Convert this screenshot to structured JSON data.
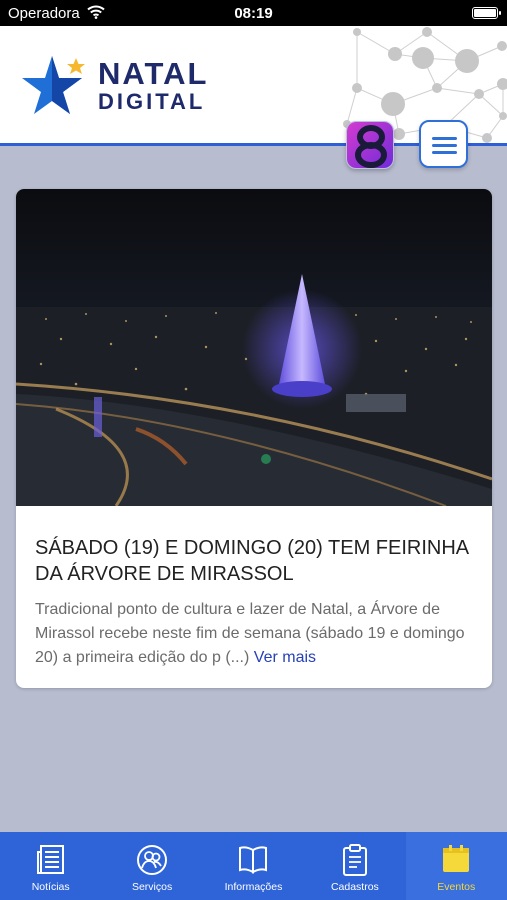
{
  "status_bar": {
    "carrier": "Operadora",
    "time": "08:19",
    "battery_level": 1.0
  },
  "header": {
    "logo_line1": "NATAL",
    "logo_line2": "DIGITAL",
    "colors": {
      "brand_navy": "#1f2a6b",
      "brand_blue": "#2f6fd8",
      "star_yellow": "#f5b82e"
    }
  },
  "app_badge": {
    "icon": "eight-app-icon"
  },
  "menu": {
    "icon": "hamburger-icon"
  },
  "event_card": {
    "title": "SÁBADO (19) E DOMINGO (20) TEM FEIRINHA DA ÁRVORE DE MIRASSOL",
    "summary": "Tradicional ponto de cultura e lazer de Natal, a Árvore de Mirassol recebe neste fim de semana (sábado 19 e domingo 20) a primeira edição do p (...)",
    "read_more": "Ver mais"
  },
  "tabbar": {
    "active_index": 4,
    "active_color": "#f5d83a",
    "tabs": [
      {
        "label": "Notícias",
        "icon": "newspaper-icon"
      },
      {
        "label": "Serviços",
        "icon": "people-icon"
      },
      {
        "label": "Informações",
        "icon": "book-icon"
      },
      {
        "label": "Cadastros",
        "icon": "clipboard-icon"
      },
      {
        "label": "Eventos",
        "icon": "calendar-icon"
      }
    ]
  }
}
